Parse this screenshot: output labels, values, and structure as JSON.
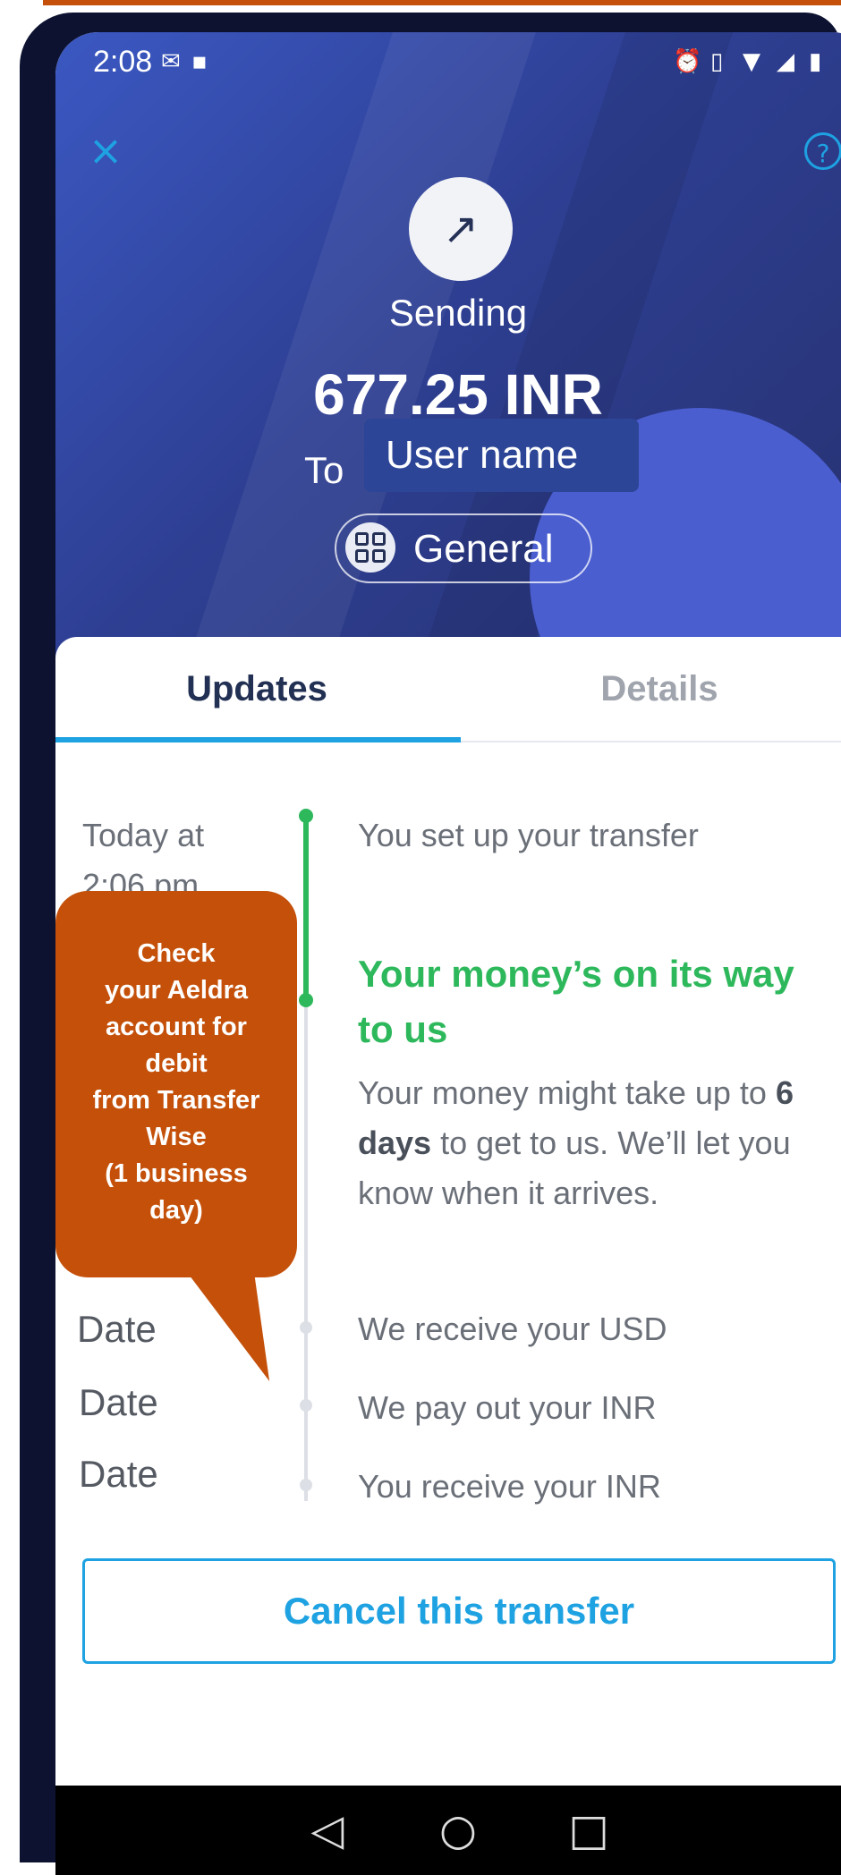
{
  "status_bar": {
    "time": "2:08",
    "left_icons": [
      "gmail-icon",
      "image-icon"
    ],
    "right_icons": [
      "alarm-icon",
      "vibrate-icon",
      "wifi-icon",
      "signal-icon",
      "battery-icon"
    ]
  },
  "header": {
    "close_icon": "close-icon",
    "help_icon": "help-icon",
    "status_label": "Sending",
    "amount": "677.25 INR",
    "to_label": "To",
    "recipient": "User name",
    "category": "General"
  },
  "tabs": [
    {
      "label": "Updates",
      "active": true
    },
    {
      "label": "Details",
      "active": false
    }
  ],
  "timeline": {
    "first_date_line1": "Today at",
    "first_date_line2": "2:06 pm",
    "steps": [
      {
        "text": "You set up your transfer",
        "state": "done"
      },
      {
        "heading": "Your money’s on its way to us",
        "body_prefix": "Your money might take up to ",
        "body_bold": "6 days",
        "body_suffix": " to get to us. We’ll let you know when it arrives.",
        "state": "current"
      },
      {
        "date": "Date",
        "text": "We receive your USD",
        "state": "pending"
      },
      {
        "date": "Date",
        "text": "We pay out your INR",
        "state": "pending"
      },
      {
        "date": "Date",
        "text": "You receive your INR",
        "state": "pending"
      }
    ]
  },
  "callout": {
    "text": "Check\nyour Aeldra\naccount for\ndebit\nfrom Transfer\nWise\n(1 business\nday)"
  },
  "actions": {
    "cancel_label": "Cancel this transfer"
  },
  "nav_bar": [
    "back-icon",
    "home-icon",
    "recents-icon"
  ],
  "colors": {
    "header_bg": "#2e3f93",
    "accent_blue": "#1ea2e2",
    "success_green": "#2eb85c",
    "callout_orange": "#c4500a"
  }
}
